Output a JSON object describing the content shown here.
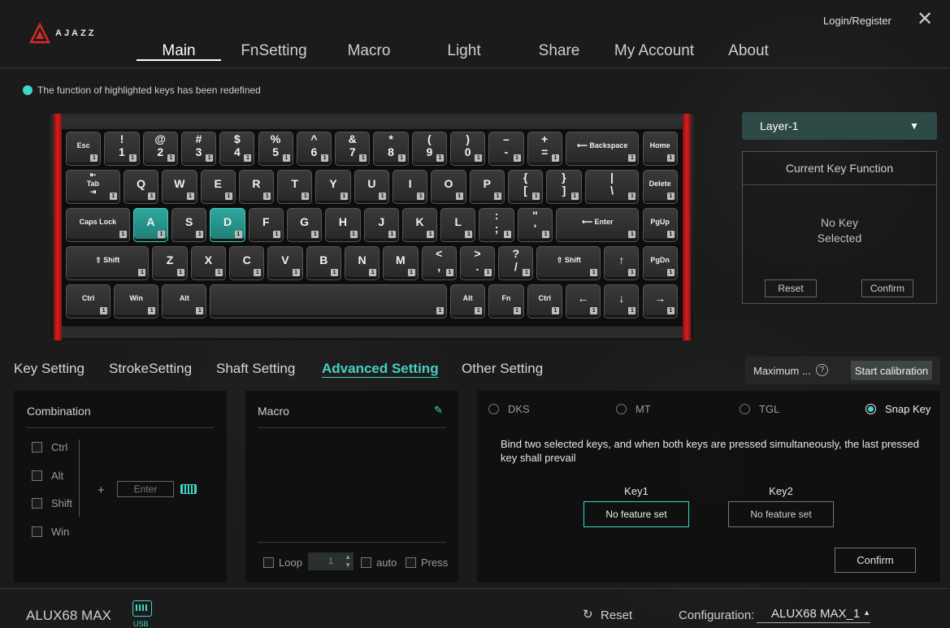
{
  "header": {
    "brand": "AJAZZ",
    "login": "Login/Register",
    "close": "✕"
  },
  "nav": {
    "tabs": [
      "Main",
      "FnSetting",
      "Macro",
      "Light",
      "Share",
      "My Account",
      "About"
    ],
    "active": "Main"
  },
  "legend": "The function of highlighted keys has been redefined",
  "keyboard": {
    "layer_badge": "1",
    "rows": [
      [
        {
          "label": "Esc"
        },
        {
          "label": "!\n1",
          "big": true
        },
        {
          "label": "@\n2",
          "big": true
        },
        {
          "label": "#\n3",
          "big": true
        },
        {
          "label": "$\n4",
          "big": true
        },
        {
          "label": "%\n5",
          "big": true
        },
        {
          "label": "^\n6",
          "big": true
        },
        {
          "label": "&\n7",
          "big": true
        },
        {
          "label": "*\n8",
          "big": true
        },
        {
          "label": "(\n9",
          "big": true
        },
        {
          "label": ")\n0",
          "big": true
        },
        {
          "label": "–\n-",
          "big": true
        },
        {
          "label": "+\n=",
          "big": true
        },
        {
          "label": "⟵ Backspace"
        },
        {
          "label": "Home"
        }
      ],
      [
        {
          "label": "⇤\nTab\n⇥"
        },
        {
          "label": "Q",
          "big": true
        },
        {
          "label": "W",
          "big": true
        },
        {
          "label": "E",
          "big": true
        },
        {
          "label": "R",
          "big": true
        },
        {
          "label": "T",
          "big": true
        },
        {
          "label": "Y",
          "big": true
        },
        {
          "label": "U",
          "big": true
        },
        {
          "label": "I",
          "big": true
        },
        {
          "label": "O",
          "big": true
        },
        {
          "label": "P",
          "big": true
        },
        {
          "label": "{\n[",
          "big": true
        },
        {
          "label": "}\n]",
          "big": true
        },
        {
          "label": "|\n\\",
          "big": true
        },
        {
          "label": "Delete"
        }
      ],
      [
        {
          "label": "Caps Lock"
        },
        {
          "label": "A",
          "big": true,
          "hl": true
        },
        {
          "label": "S",
          "big": true
        },
        {
          "label": "D",
          "big": true,
          "hl": true
        },
        {
          "label": "F",
          "big": true
        },
        {
          "label": "G",
          "big": true
        },
        {
          "label": "H",
          "big": true
        },
        {
          "label": "J",
          "big": true
        },
        {
          "label": "K",
          "big": true
        },
        {
          "label": "L",
          "big": true
        },
        {
          "label": ":\n;",
          "big": true
        },
        {
          "label": "\"\n'",
          "big": true
        },
        {
          "label": "⟵ Enter"
        },
        {
          "label": "PgUp"
        }
      ],
      [
        {
          "label": "⇧ Shift"
        },
        {
          "label": "Z",
          "big": true
        },
        {
          "label": "X",
          "big": true
        },
        {
          "label": "C",
          "big": true
        },
        {
          "label": "V",
          "big": true
        },
        {
          "label": "B",
          "big": true
        },
        {
          "label": "N",
          "big": true
        },
        {
          "label": "M",
          "big": true
        },
        {
          "label": "<\n,",
          "big": true
        },
        {
          "label": ">\n.",
          "big": true
        },
        {
          "label": "?\n/",
          "big": true
        },
        {
          "label": "⇧ Shift"
        },
        {
          "label": "↑",
          "big": true
        },
        {
          "label": "PgDn"
        }
      ],
      [
        {
          "label": "Ctrl"
        },
        {
          "label": "Win"
        },
        {
          "label": "Alt"
        },
        {
          "label": ""
        },
        {
          "label": "Alt"
        },
        {
          "label": "Fn"
        },
        {
          "label": "Ctrl"
        },
        {
          "label": "←",
          "big": true
        },
        {
          "label": "↓",
          "big": true
        },
        {
          "label": "→",
          "big": true
        }
      ]
    ]
  },
  "right_panel": {
    "layer": "Layer-1",
    "current_key_title": "Current Key Function",
    "no_key": "No Key\nSelected",
    "reset": "Reset",
    "confirm": "Confirm"
  },
  "setting_tabs": {
    "tabs": [
      "Key Setting",
      "StrokeSetting",
      "Shaft Setting",
      "Advanced Setting",
      "Other Setting"
    ],
    "active": "Advanced Setting",
    "maximum": "Maximum ...",
    "help": "?",
    "calibration": "Start calibration"
  },
  "combination": {
    "title": "Combination",
    "modifiers": [
      "Ctrl",
      "Alt",
      "Shift",
      "Win"
    ],
    "plus": "+",
    "key_placeholder": "Enter"
  },
  "macro": {
    "title": "Macro",
    "loop": "Loop",
    "loop_count": "1",
    "auto": "auto",
    "press": "Press"
  },
  "advanced": {
    "modes": [
      "DKS",
      "MT",
      "TGL",
      "Snap Key"
    ],
    "selected": "Snap Key",
    "description": "Bind two selected keys, and when both keys are pressed simultaneously, the last pressed key shall prevail",
    "key1_label": "Key1",
    "key2_label": "Key2",
    "key1_value": "No feature set",
    "key2_value": "No feature set",
    "confirm": "Confirm"
  },
  "footer": {
    "device": "ALUX68 MAX",
    "connection": "USB",
    "reset": "Reset",
    "config_label": "Configuration:",
    "config_value": "ALUX68 MAX_1"
  },
  "colors": {
    "accent": "#3ed6c8",
    "frame_red": "#d32020",
    "layer_select": "#2e4a47"
  }
}
